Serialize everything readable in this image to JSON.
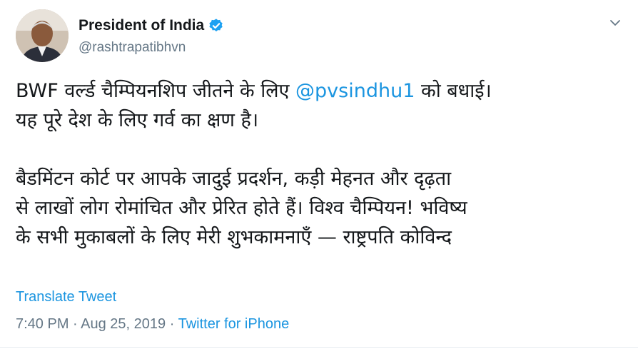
{
  "author": {
    "display_name": "President of India",
    "handle": "@rashtrapatibhvn",
    "verified": true,
    "avatar_icon": "profile-photo",
    "verified_color": "#1da1f2"
  },
  "tweet": {
    "line1_prefix": "BWF वर्ल्ड चैम्पियनशिप जीतने के लिए ",
    "mention": "@pvsindhu1",
    "line1_suffix": " को बधाई।",
    "line2": "यह पूरे देश के लिए गर्व का क्षण है।",
    "para2_line1": "बैडमिंटन कोर्ट पर आपके जादुई प्रदर्शन, कड़ी मेहनत और दृढ़ता",
    "para2_line2": "से लाखों लोग रोमांचित और प्रेरित होते हैं। विश्व चैम्पियन! भविष्य",
    "para2_line3": "के सभी मुकाबलों के लिए मेरी शुभकामनाएँ — राष्ट्रपति कोविन्द"
  },
  "actions": {
    "translate_label": "Translate Tweet",
    "menu_icon": "chevron-down-icon"
  },
  "meta": {
    "time": "7:40 PM",
    "separator1": " · ",
    "date": "Aug 25, 2019",
    "separator2": " · ",
    "source": "Twitter for iPhone"
  },
  "colors": {
    "link": "#1b95e0",
    "secondary_text": "#657786",
    "primary_text": "#14171a"
  }
}
